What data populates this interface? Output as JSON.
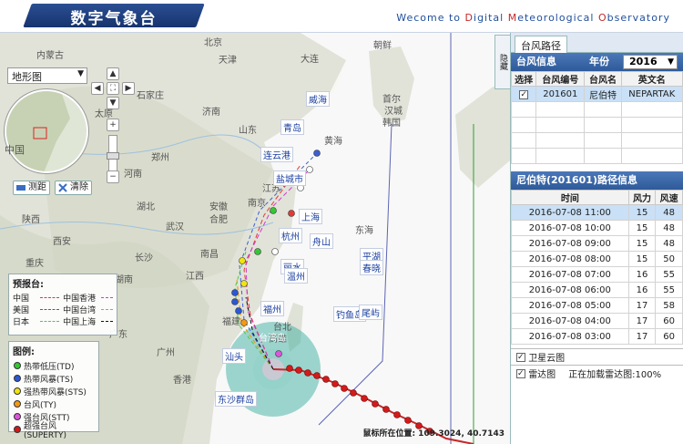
{
  "header": {
    "logo_text": "数字气象台",
    "welcome": {
      "prefix": "Wecome to ",
      "d": "D",
      "igital": "igital ",
      "m": "M",
      "eteorological": "eteorological ",
      "o": "O",
      "bservatory": "bservatory"
    }
  },
  "map": {
    "type_select": "地形图",
    "tools": {
      "measure": "测距",
      "clear": "清除"
    },
    "cities": [
      "北京",
      "天津",
      "朝鲜",
      "首尔",
      "汉城",
      "韩国",
      "济南",
      "山东",
      "青岛",
      "江苏",
      "安徽",
      "合肥",
      "南京",
      "湖北",
      "武汉",
      "长沙",
      "湖南",
      "江西",
      "南昌",
      "福建",
      "广东",
      "广州",
      "香港",
      "台北",
      "台湾",
      "高雄",
      "宁德",
      "中国",
      "黄海",
      "东海",
      "杭州",
      "浙江",
      "石家庄",
      "太原",
      "陕西",
      "西安",
      "郑州",
      "河南",
      "重庆",
      "大连",
      "内蒙古"
    ],
    "labels": [
      "威海",
      "青岛",
      "连云港",
      "盐城市",
      "上海",
      "杭州",
      "舟山",
      "平湖",
      "春晓",
      "丽水",
      "温州",
      "福州",
      "钓鱼岛",
      "尾屿",
      "汕头",
      "东沙群岛",
      "台湾岛",
      "台北"
    ],
    "forecast_title": "预报台:",
    "forecast": [
      {
        "name": "中国",
        "color": "#e53935"
      },
      {
        "name": "中国香港",
        "color": "#d03ad0"
      },
      {
        "name": "美国",
        "color": "#3c5fd0"
      },
      {
        "name": "中国台湾",
        "color": "#f29100"
      },
      {
        "name": "日本",
        "color": "#4ccb4c"
      },
      {
        "name": "中国上海",
        "color": "#111111"
      }
    ],
    "legend_title": "图例:",
    "legend": [
      {
        "label": "热带低压(TD)",
        "color": "#35c635"
      },
      {
        "label": "热带风暴(TS)",
        "color": "#2b58d6"
      },
      {
        "label": "强热带风暴(STS)",
        "color": "#f1e40f"
      },
      {
        "label": "台风(TY)",
        "color": "#f39a12"
      },
      {
        "label": "强台风(STT)",
        "color": "#dc55dc"
      },
      {
        "label": "超强台风(SUPERTY)",
        "color": "#d01a1a"
      }
    ],
    "mouse_pos": "鼠标所在位置: 109.3024, 40.7143"
  },
  "panel": {
    "tab": "台风路径",
    "hide": "隐藏",
    "info_title": "台风信息",
    "year_label": "年份",
    "year": "2016",
    "list_headers": [
      "选择",
      "台风编号",
      "台风名",
      "英文名"
    ],
    "list_rows": [
      {
        "checked": "✓",
        "id": "201601",
        "name": "尼伯特",
        "en": "NEPARTAK"
      }
    ],
    "path_title": "尼伯特(201601)路径信息",
    "path_headers": [
      "时间",
      "风力",
      "风速"
    ],
    "path_rows": [
      {
        "t": "2016-07-08 11:00",
        "f": "15",
        "s": "48"
      },
      {
        "t": "2016-07-08 10:00",
        "f": "15",
        "s": "48"
      },
      {
        "t": "2016-07-08 09:00",
        "f": "15",
        "s": "48"
      },
      {
        "t": "2016-07-08 08:00",
        "f": "15",
        "s": "50"
      },
      {
        "t": "2016-07-08 07:00",
        "f": "16",
        "s": "55"
      },
      {
        "t": "2016-07-08 06:00",
        "f": "16",
        "s": "55"
      },
      {
        "t": "2016-07-08 05:00",
        "f": "17",
        "s": "58"
      },
      {
        "t": "2016-07-08 04:00",
        "f": "17",
        "s": "60"
      },
      {
        "t": "2016-07-08 03:00",
        "f": "17",
        "s": "60"
      }
    ],
    "satellite": "卫星云图",
    "radar": "雷达图",
    "radar_status": "正在加载雷达图:100%"
  },
  "colors": {
    "accent": "#2e5a9a",
    "selected_row": "#c9e0f6",
    "warn_circle": "#2aa89a"
  }
}
